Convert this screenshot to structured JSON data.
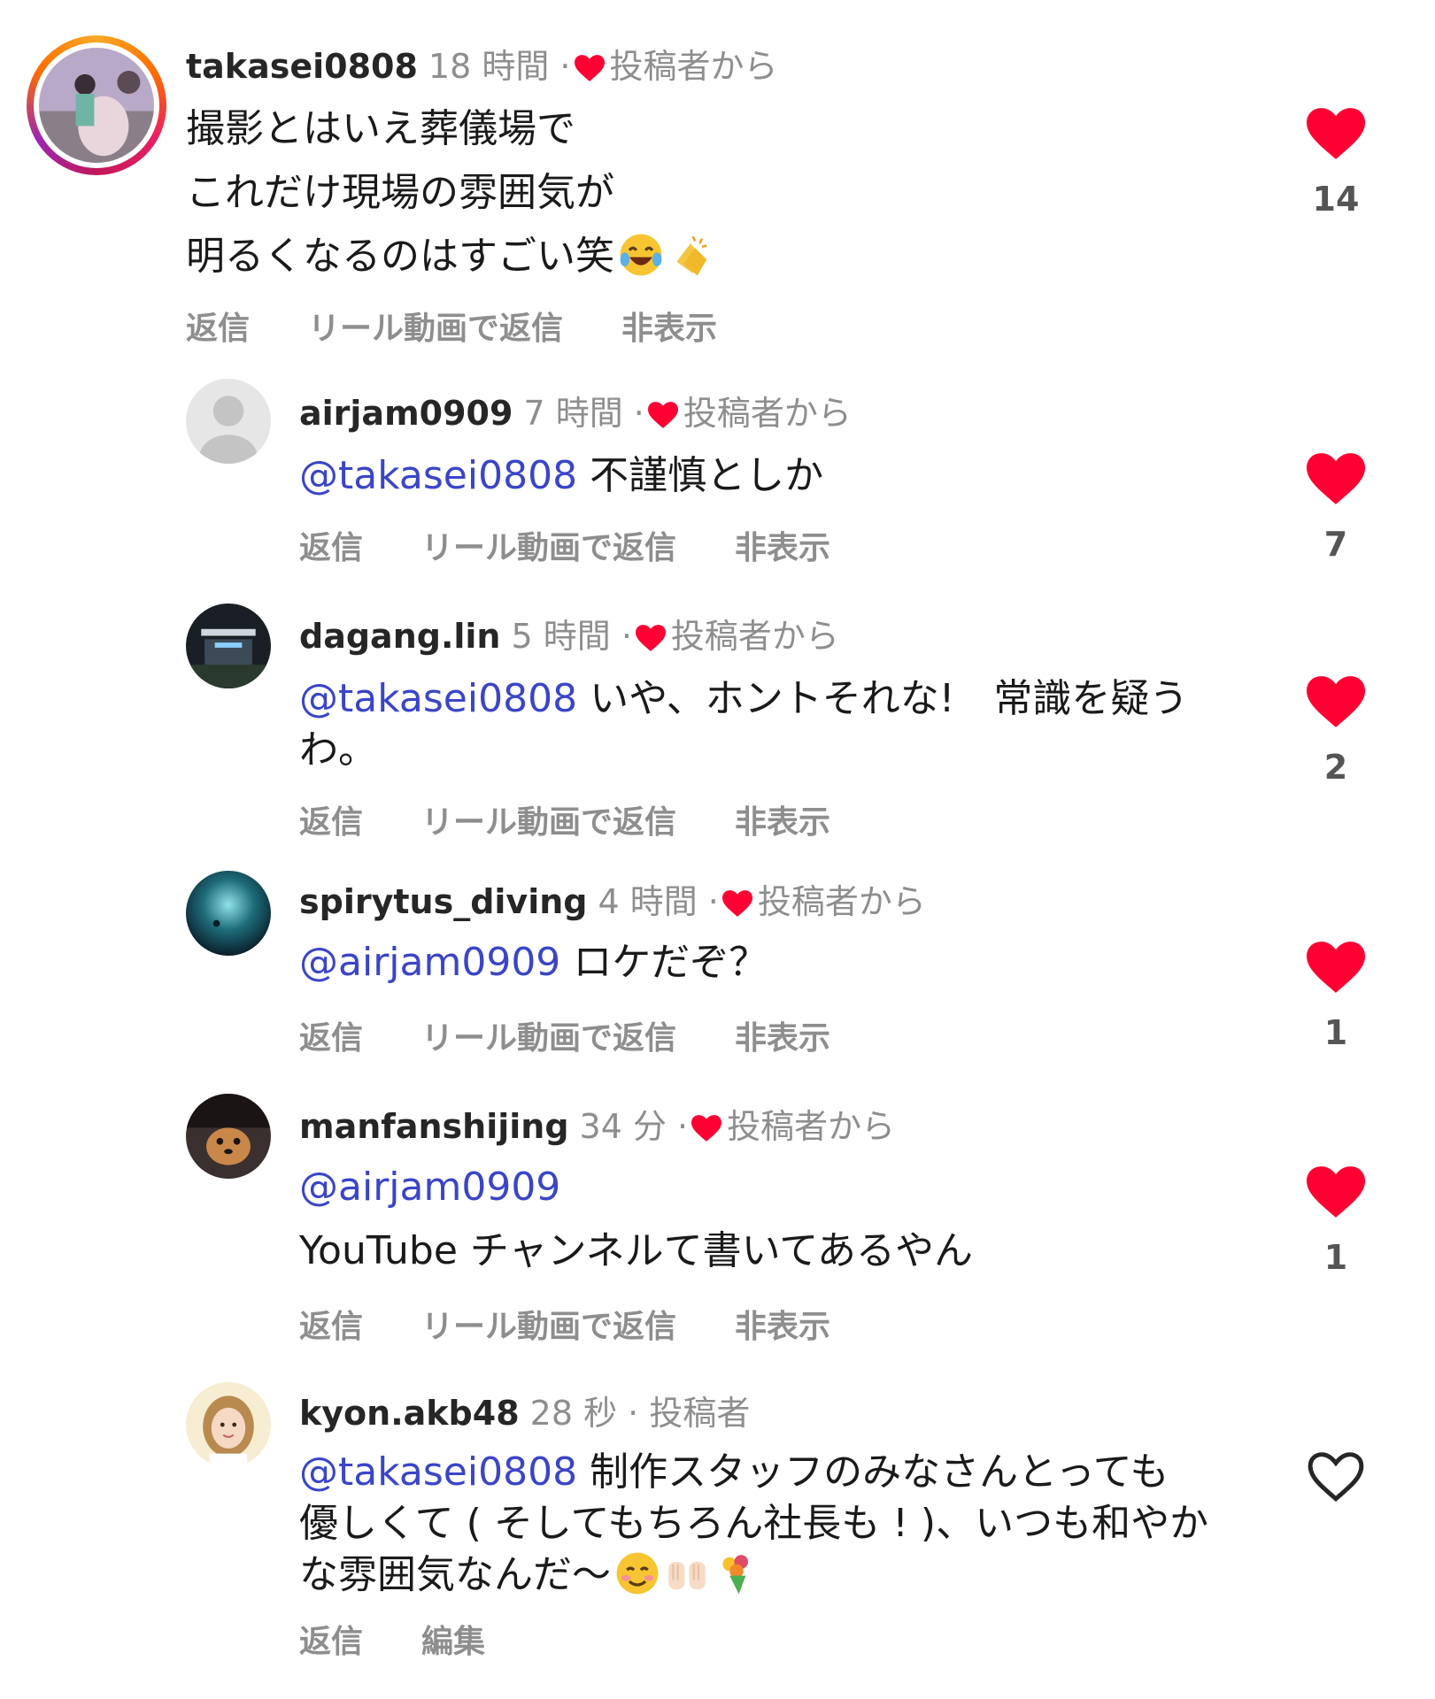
{
  "comments": [
    {
      "user": "takasei0808",
      "time": "18 時間 ·",
      "badge": "投稿者から",
      "lines": [
        "撮影とはいえ葬儀場で",
        "これだけ現場の雰囲気が",
        "明るくなるのはすごい笑"
      ],
      "likes": "14",
      "liked": true
    },
    {
      "user": "airjam0909",
      "time": "7 時間 ·",
      "badge": "投稿者から",
      "mention": "@takasei0808",
      "text": "不謹慎としか",
      "likes": "7",
      "liked": true
    },
    {
      "user": "dagang.lin",
      "time": "5 時間 ·",
      "badge": "投稿者から",
      "mention": "@takasei0808",
      "text": "いや、ホントそれな!　常識を疑う",
      "text2": "わ。",
      "likes": "2",
      "liked": true
    },
    {
      "user": "spirytus_diving",
      "time": "4 時間 ·",
      "badge": "投稿者から",
      "mention": "@airjam0909",
      "text": "ロケだぞ？",
      "likes": "1",
      "liked": true
    },
    {
      "user": "manfanshijing",
      "time": "34 分 ·",
      "badge": "投稿者から",
      "mention": "@airjam0909",
      "text2": "YouTube チャンネルて書いてあるやん",
      "likes": "1",
      "liked": true
    },
    {
      "user": "kyon.akb48",
      "time": "28 秒 ·",
      "badge": "投稿者",
      "mention": "@takasei0808",
      "text": "制作スタッフのみなさんとっても",
      "text2": "優しくて ( そしてもちろん社長も ! )、いつも和やか",
      "text3": "な雰囲気なんだ〜",
      "likes": "",
      "liked": false
    }
  ],
  "actions": {
    "reply": "返信",
    "reply_reel": "リール動画で返信",
    "hide": "非表示",
    "edit": "編集"
  },
  "colors": {
    "mention": "#3a45c8",
    "heart": "#ff0033",
    "meta": "#8e8e8e"
  }
}
